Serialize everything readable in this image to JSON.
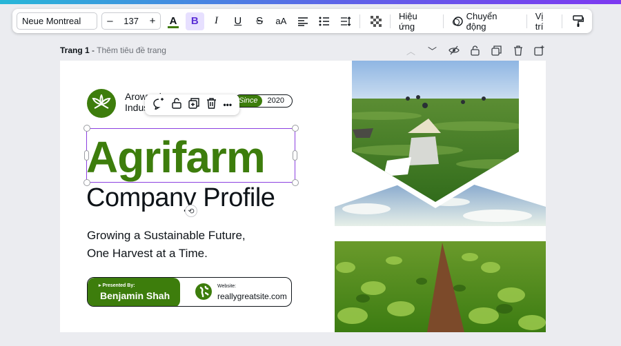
{
  "toolbar": {
    "font_name": "Neue Montreal",
    "font_size": "137",
    "decrease_label": "–",
    "increase_label": "+",
    "text_color_label": "A",
    "bold_label": "B",
    "italic_label": "I",
    "underline_label": "U",
    "strike_label": "S",
    "case_label": "aA",
    "effects_label": "Hiệu ứng",
    "animate_label": "Chuyển động",
    "position_label": "Vị trí"
  },
  "page": {
    "label": "Trang 1",
    "title_placeholder": "Thêm tiêu đề trang"
  },
  "context_menu": {
    "more_label": "•••"
  },
  "design": {
    "company_name": "Arowwai Industries",
    "since_label": "Since",
    "since_year": "2020",
    "title": "Agrifarm",
    "subtitle": "Company Profile",
    "tagline_line1": "Growing a Sustainable Future,",
    "tagline_line2": "One Harvest at a Time.",
    "presented_by_label": "Presented By:",
    "presenter_name": "Benjamin Shah",
    "website_label": "Website:",
    "website_url": "reallygreatsite.com"
  },
  "colors": {
    "accent_green": "#3d7d0c",
    "selection_purple": "#8b3fe0",
    "bold_active_bg": "#e7e0ff"
  }
}
